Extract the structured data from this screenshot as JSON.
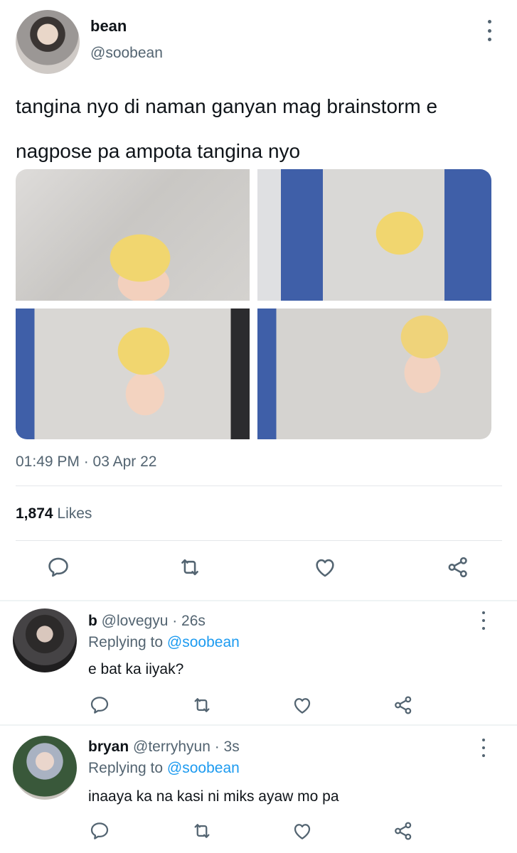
{
  "tweet": {
    "author_name": "bean",
    "author_handle": "@soobean",
    "text_line1": "tangina nyo di naman ganyan mag brainstorm e",
    "text_line2": "nagpose pa ampota tangina nyo",
    "timestamp": "01:49 PM · 03 Apr 22",
    "likes_count": "1,874",
    "likes_label": "Likes"
  },
  "replies": [
    {
      "name": "b",
      "handle": "@lovegyu",
      "time": "· 26s",
      "replying_prefix": "Replying to",
      "replying_to": "@soobean",
      "text": "e bat ka iiyak?"
    },
    {
      "name": "bryan",
      "handle": "@terryhyun",
      "time": "· 3s",
      "replying_prefix": "Replying to",
      "replying_to": "@soobean",
      "text": "inaaya ka na kasi ni miks ayaw mo pa"
    }
  ],
  "icons": {
    "reply": "reply-icon",
    "retweet": "retweet-icon",
    "like": "heart-icon",
    "share": "share-icon",
    "more": "more-vertical-icon"
  },
  "colors": {
    "text": "#0f1419",
    "secondary": "#536471",
    "link": "#1d9bf0",
    "divider": "#e4e7ea"
  }
}
